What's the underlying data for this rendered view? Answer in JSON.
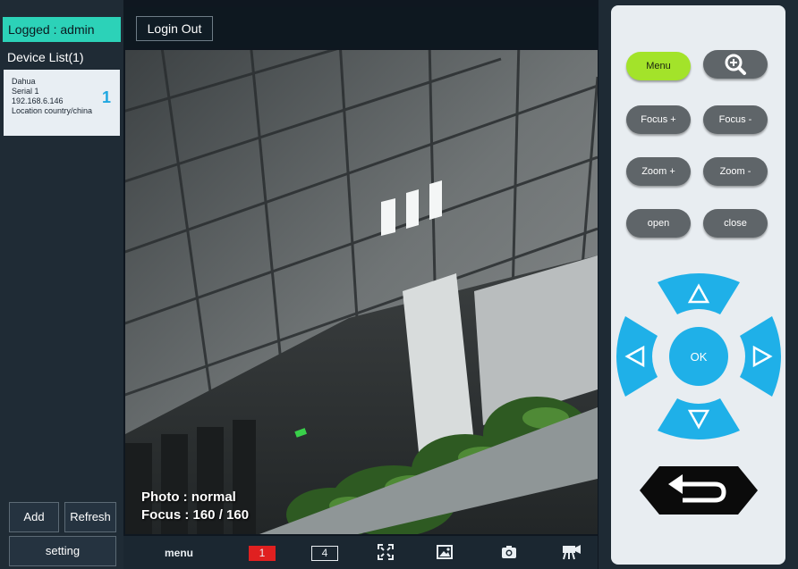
{
  "sidebar": {
    "logged_label": "Logged : admin",
    "device_list_title": "Device List(1)",
    "device": {
      "brand": "Dahua",
      "serial": "Serial 1",
      "ip": "192.168.6.146",
      "location": "Location country/china",
      "number": "1"
    },
    "add_label": "Add",
    "refresh_label": "Refresh",
    "setting_label": "setting"
  },
  "topbar": {
    "login_out_label": "Login Out"
  },
  "video": {
    "photo_text": "Photo : normal",
    "focus_text": "Focus : 160 / 160"
  },
  "toolbar": {
    "menu_label": "menu",
    "single_view_label": "1",
    "quad_view_label": "4"
  },
  "panel": {
    "menu_label": "Menu",
    "focus_plus_label": "Focus +",
    "focus_minus_label": "Focus -",
    "zoom_plus_label": "Zoom +",
    "zoom_minus_label": "Zoom -",
    "open_label": "open",
    "close_label": "close",
    "ok_label": "OK"
  },
  "colors": {
    "accent_teal": "#2cd2b8",
    "menu_green": "#a3e32a",
    "dpad_blue": "#1fb0e8",
    "record_red": "#e02020"
  },
  "icons": [
    "magnify-icon",
    "fullscreen-icon",
    "image-icon",
    "camera-icon",
    "record-icon",
    "return-icon",
    "arrow-up-icon",
    "arrow-down-icon",
    "arrow-left-icon",
    "arrow-right-icon"
  ]
}
